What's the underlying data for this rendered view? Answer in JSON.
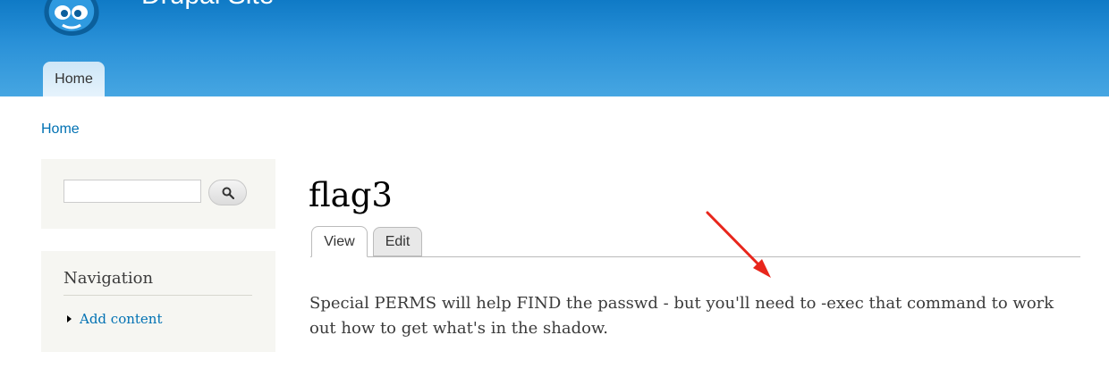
{
  "header": {
    "site_name": "Drupal Site",
    "main_menu": [
      {
        "label": "Home"
      }
    ]
  },
  "breadcrumb": {
    "label": "Home"
  },
  "sidebar": {
    "search": {
      "placeholder": "",
      "button_icon": "search-icon"
    },
    "navigation": {
      "title": "Navigation",
      "items": [
        {
          "label": "Add content"
        }
      ]
    }
  },
  "content": {
    "title": "flag3",
    "tabs": [
      {
        "label": "View",
        "active": true
      },
      {
        "label": "Edit",
        "active": false
      }
    ],
    "body": "Special PERMS will help FIND the passwd - but you'll need to -exec that command to work out how to get what's in the shadow."
  },
  "annotation": {
    "color": "#e8261c"
  },
  "colors": {
    "header_top": "#0f7ac6",
    "header_bottom": "#46a6e2",
    "link": "#0071b3",
    "sidebar_bg": "#f6f6f2"
  }
}
